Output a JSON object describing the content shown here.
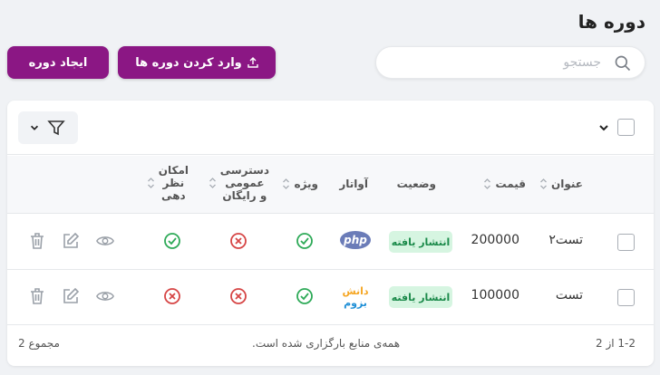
{
  "page": {
    "title": "دوره ها"
  },
  "search": {
    "placeholder": "جستجو",
    "value": ""
  },
  "buttons": {
    "import_label": "وارد کردن دوره ها",
    "create_label": "ایجاد دوره"
  },
  "table": {
    "headers": {
      "title": "عنوان",
      "price": "قیمت",
      "status": "وضعیت",
      "avatar": "آواتار",
      "special": "ویژه",
      "public_access_line1": "دسترسی",
      "public_access_line2": "عمومی",
      "public_access_line3": "و رایگان",
      "comments_line1": "امکان",
      "comments_line2": "نظر",
      "comments_line3": "دهی"
    },
    "rows": [
      {
        "title": "تست۲",
        "price": "200000",
        "status": "انتشار یافته",
        "avatar": "php-logo",
        "special": true,
        "public_access": false,
        "comments": true
      },
      {
        "title": "تست",
        "price": "100000",
        "status": "انتشار یافته",
        "avatar": "danesh-logo",
        "special": true,
        "public_access": false,
        "comments": false
      }
    ],
    "avatar_text": {
      "php": "php",
      "danesh_top": "دانش",
      "danesh_bottom": "بزوم"
    }
  },
  "footer": {
    "range": "1-2 از 2",
    "message": "همه‌ی منابع بارگزاری شده است.",
    "total": "مجموع 2"
  },
  "colors": {
    "primary": "#8b1784",
    "success": "#2eaa58",
    "danger": "#d64545",
    "badge_bg": "#d6f5e1",
    "badge_text": "#1b8a4a"
  }
}
